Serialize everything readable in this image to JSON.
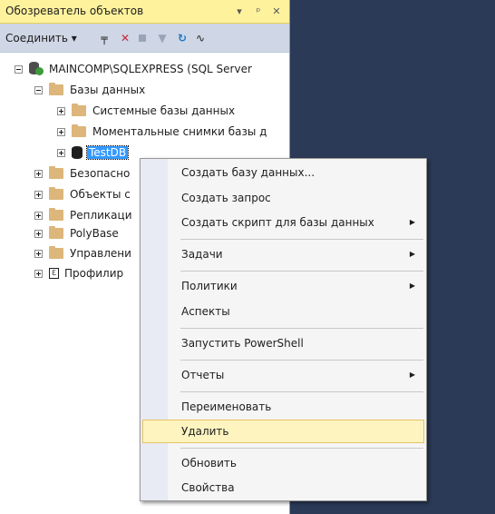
{
  "panel": {
    "title": "Обозреватель объектов",
    "title_buttons": [
      "▾",
      "ᵖ",
      "✕"
    ]
  },
  "toolbar": {
    "connect_label": "Соединить ▾",
    "icons": [
      "connect-icon",
      "disconnect-icon",
      "stop-icon",
      "filter-icon",
      "refresh-icon",
      "activity-monitor-icon"
    ]
  },
  "tree": {
    "server": "MAINCOMP\\SQLEXPRESS (SQL Server",
    "databases": "Базы данных",
    "system_dbs": "Системные базы данных",
    "snapshots": "Моментальные снимки базы д",
    "testdb": "TestDB",
    "security": "Безопасно",
    "server_objects": "Объекты с",
    "replication": "Репликаци",
    "polybase": "PolyBase",
    "management": "Управлени",
    "profiler": "Профилир"
  },
  "context_menu": {
    "items": [
      {
        "label": "Создать базу данных...",
        "submenu": false
      },
      {
        "label": "Создать запрос",
        "submenu": false
      },
      {
        "label": "Создать скрипт для базы данных",
        "submenu": true
      },
      {
        "label": "Задачи",
        "submenu": true
      },
      {
        "label": "Политики",
        "submenu": true
      },
      {
        "label": "Аспекты",
        "submenu": false
      },
      {
        "label": "Запустить PowerShell",
        "submenu": false
      },
      {
        "label": "Отчеты",
        "submenu": true
      },
      {
        "label": "Переименовать",
        "submenu": false
      },
      {
        "label": "Удалить",
        "submenu": false,
        "highlighted": true
      },
      {
        "label": "Обновить",
        "submenu": false
      },
      {
        "label": "Свойства",
        "submenu": false
      }
    ],
    "submenu_arrow": "▶"
  },
  "colors": {
    "title_bg": "#fff29d",
    "toolbar_bg": "#cfd6e5",
    "selection": "#3399ff",
    "menu_hover": "#fdf4bf",
    "background": "#293955"
  }
}
